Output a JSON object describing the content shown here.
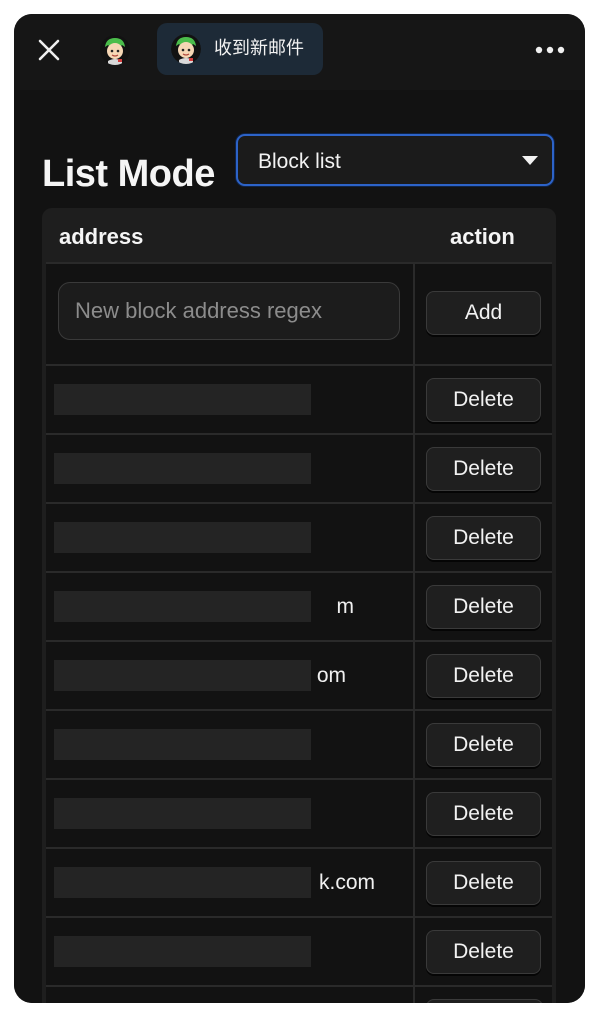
{
  "topbar": {
    "tab_label": "收到新邮件"
  },
  "page": {
    "title": "List Mode"
  },
  "list_mode_select": {
    "value": "Block list"
  },
  "table": {
    "headers": [
      "address",
      "action"
    ],
    "new_address": {
      "placeholder": "New block address regex",
      "value": ""
    },
    "add_label": "Add",
    "rows": [
      {
        "address_visible": "",
        "action": "Delete"
      },
      {
        "address_visible": "",
        "action": "Delete"
      },
      {
        "address_visible": "",
        "action": "Delete"
      },
      {
        "address_visible": "m",
        "action": "Delete"
      },
      {
        "address_visible": "om",
        "action": "Delete"
      },
      {
        "address_visible": "",
        "action": "Delete"
      },
      {
        "address_visible": "",
        "action": "Delete"
      },
      {
        "address_visible": "k.com",
        "action": "Delete"
      },
      {
        "address_visible": "",
        "action": "Delete"
      }
    ]
  },
  "icons": {
    "close": "close-icon",
    "more": "more-horizontal-icon",
    "caret": "caret-down-icon"
  }
}
